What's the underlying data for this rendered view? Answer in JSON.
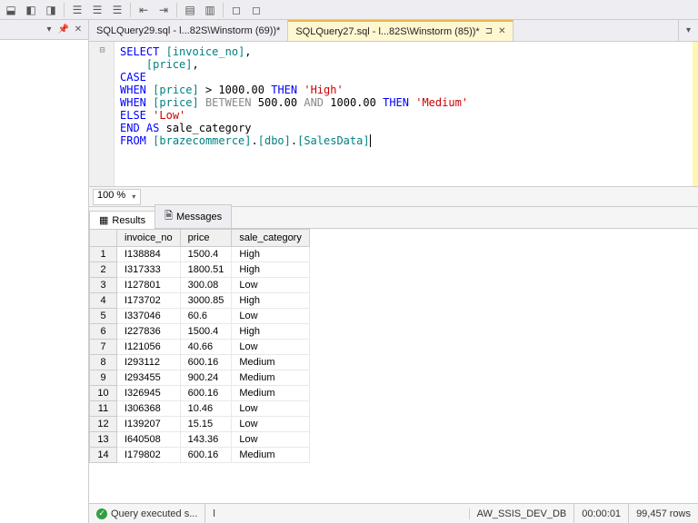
{
  "tabs": [
    {
      "label": "SQLQuery29.sql - l...82S\\Winstorm (69))*",
      "active": false
    },
    {
      "label": "SQLQuery27.sql - l...82S\\Winstorm (85))*",
      "active": true
    }
  ],
  "zoom": "100 %",
  "editor_lines": [
    [
      {
        "t": "SELECT",
        "c": "sk"
      },
      {
        "t": " "
      },
      {
        "t": "[invoice_no]",
        "c": "si"
      },
      {
        "t": ","
      }
    ],
    [
      {
        "t": "    "
      },
      {
        "t": "[price]",
        "c": "si"
      },
      {
        "t": ","
      }
    ],
    [
      {
        "t": "CASE",
        "c": "sk"
      }
    ],
    [
      {
        "t": "WHEN",
        "c": "sk"
      },
      {
        "t": " "
      },
      {
        "t": "[price]",
        "c": "si"
      },
      {
        "t": " > "
      },
      {
        "t": "1000.00",
        "c": "sn"
      },
      {
        "t": " "
      },
      {
        "t": "THEN",
        "c": "sk"
      },
      {
        "t": " "
      },
      {
        "t": "'High'",
        "c": "ss"
      }
    ],
    [
      {
        "t": "WHEN",
        "c": "sk"
      },
      {
        "t": " "
      },
      {
        "t": "[price]",
        "c": "si"
      },
      {
        "t": " "
      },
      {
        "t": "BETWEEN",
        "c": "sg"
      },
      {
        "t": " "
      },
      {
        "t": "500.00",
        "c": "sn"
      },
      {
        "t": " "
      },
      {
        "t": "AND",
        "c": "sg"
      },
      {
        "t": " "
      },
      {
        "t": "1000.00",
        "c": "sn"
      },
      {
        "t": " "
      },
      {
        "t": "THEN",
        "c": "sk"
      },
      {
        "t": " "
      },
      {
        "t": "'Medium'",
        "c": "ss"
      }
    ],
    [
      {
        "t": "ELSE",
        "c": "sk"
      },
      {
        "t": " "
      },
      {
        "t": "'Low'",
        "c": "ss"
      }
    ],
    [
      {
        "t": "END",
        "c": "sk"
      },
      {
        "t": " "
      },
      {
        "t": "AS",
        "c": "sk"
      },
      {
        "t": " sale_category"
      }
    ],
    [
      {
        "t": "FROM",
        "c": "sk"
      },
      {
        "t": " "
      },
      {
        "t": "[brazecommerce]",
        "c": "si"
      },
      {
        "t": "."
      },
      {
        "t": "[dbo]",
        "c": "si"
      },
      {
        "t": "."
      },
      {
        "t": "[SalesData]",
        "c": "si"
      },
      {
        "t": "",
        "c": "scur"
      }
    ]
  ],
  "results_tabs": [
    {
      "icon": "▦",
      "label": "Results",
      "active": true
    },
    {
      "icon": "🗎",
      "label": "Messages",
      "active": false
    }
  ],
  "grid": {
    "columns": [
      "invoice_no",
      "price",
      "sale_category"
    ],
    "rows": [
      [
        "I138884",
        "1500.4",
        "High"
      ],
      [
        "I317333",
        "1800.51",
        "High"
      ],
      [
        "I127801",
        "300.08",
        "Low"
      ],
      [
        "I173702",
        "3000.85",
        "High"
      ],
      [
        "I337046",
        "60.6",
        "Low"
      ],
      [
        "I227836",
        "1500.4",
        "High"
      ],
      [
        "I121056",
        "40.66",
        "Low"
      ],
      [
        "I293112",
        "600.16",
        "Medium"
      ],
      [
        "I293455",
        "900.24",
        "Medium"
      ],
      [
        "I326945",
        "600.16",
        "Medium"
      ],
      [
        "I306368",
        "10.46",
        "Low"
      ],
      [
        "I139207",
        "15.15",
        "Low"
      ],
      [
        "I640508",
        "143.36",
        "Low"
      ],
      [
        "I179802",
        "600.16",
        "Medium"
      ]
    ]
  },
  "status": {
    "exec": "Query executed s...",
    "server": "l",
    "db": "AW_SSIS_DEV_DB",
    "elapsed": "00:00:01",
    "rows": "99,457 rows"
  }
}
